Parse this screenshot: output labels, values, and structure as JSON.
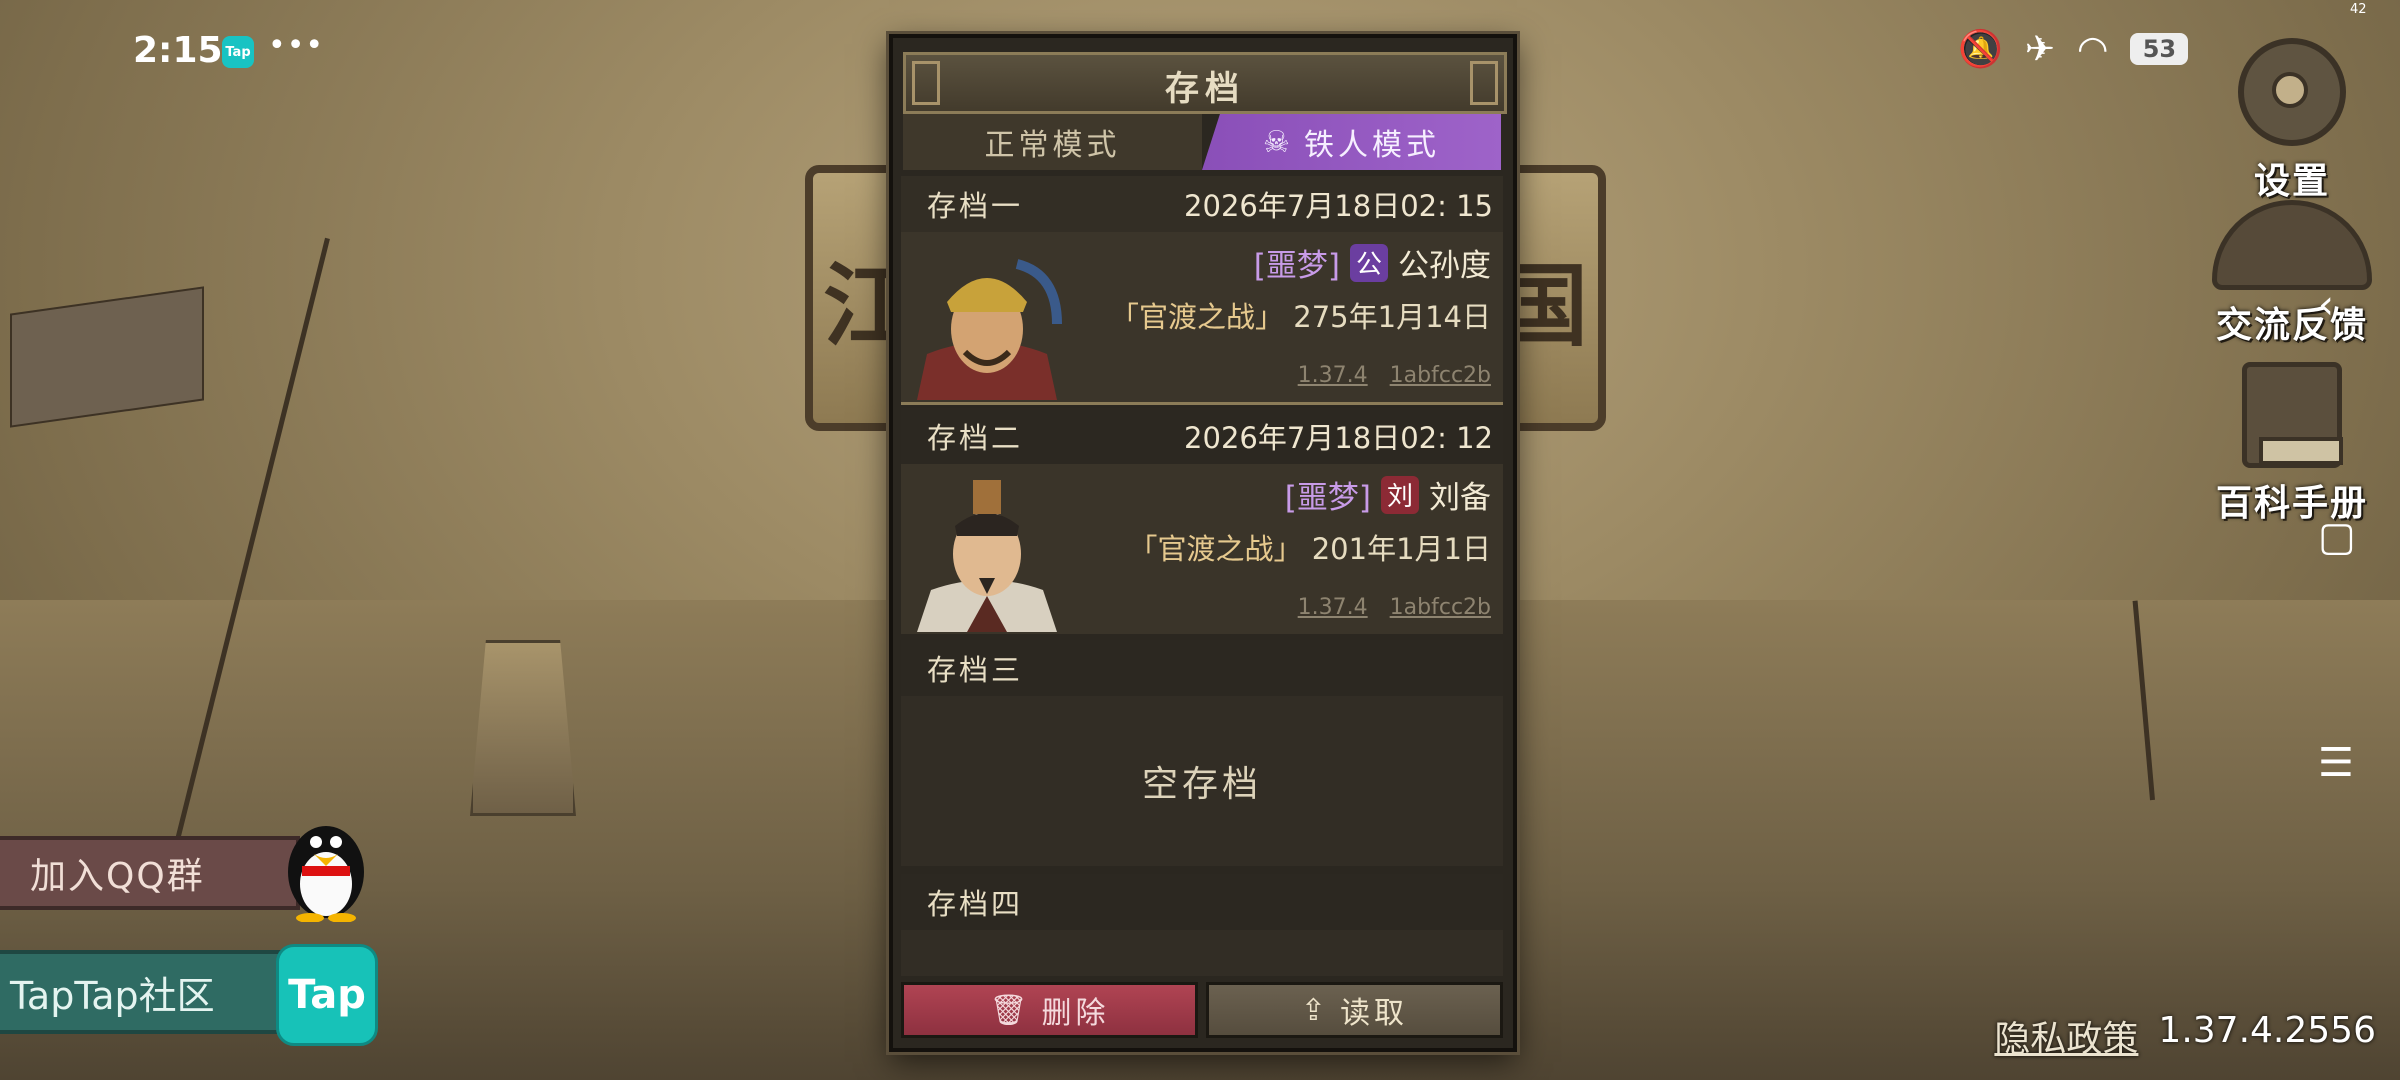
{
  "status_bar": {
    "time": "2:15",
    "app_badge": "Tap",
    "more": "•••",
    "battery": "53",
    "corner_number": "42"
  },
  "background": {
    "logo_left_char": "江",
    "logo_right_char": "国"
  },
  "panel": {
    "title": "存档",
    "tabs": [
      {
        "label": "正常模式",
        "active": false
      },
      {
        "label": "铁人模式",
        "icon": "skull-crossbones-icon",
        "active": true
      }
    ],
    "slots": [
      {
        "name": "存档一",
        "date": "2026年7月18日02: 15",
        "difficulty": "[噩梦]",
        "faction_badge": "公",
        "hero": "公孙度",
        "battle": "「官渡之战」",
        "game_date": "275年1月14日",
        "version": "1.37.4",
        "hash": "1abfcc2b"
      },
      {
        "name": "存档二",
        "date": "2026年7月18日02: 12",
        "difficulty": "[噩梦]",
        "faction_badge": "刘",
        "hero": "刘备",
        "battle": "「官渡之战」",
        "game_date": "201年1月1日",
        "version": "1.37.4",
        "hash": "1abfcc2b"
      },
      {
        "name": "存档三",
        "empty_text": "空存档"
      },
      {
        "name": "存档四"
      }
    ],
    "delete_label": "删除",
    "load_label": "读取"
  },
  "side_menu": {
    "settings": "设置",
    "feedback": "交流反馈",
    "wiki": "百科手册"
  },
  "promo": {
    "qq": "加入QQ群",
    "taptap": "TapTap社区",
    "tap_logo": "Tap"
  },
  "footer": {
    "privacy": "隐私政策",
    "version": "1.37.4.2556"
  },
  "colors": {
    "iron_mode_accent": "#9e63c9",
    "delete_button": "#b04453",
    "taptap": "#17c2b8"
  }
}
